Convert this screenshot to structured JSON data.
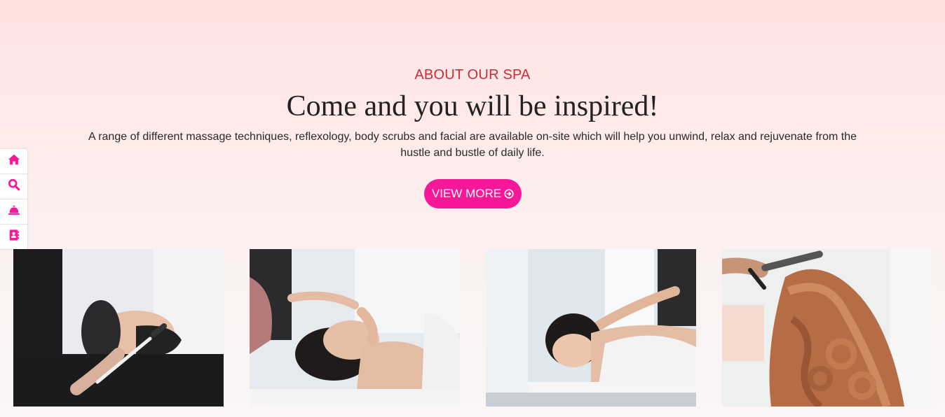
{
  "about": {
    "eyebrow": "ABOUT OUR SPA",
    "headline": "Come and you will be inspired!",
    "description": "A range of different massage techniques, reflexology, body scrubs and facial are available on-site which will help you unwind, relax and rejuvenate from the hustle and bustle of daily life.",
    "button_label": "VIEW MORE"
  },
  "side_toolbar": [
    {
      "icon": "home-icon"
    },
    {
      "icon": "search-icon"
    },
    {
      "icon": "service-bell-icon"
    },
    {
      "icon": "contact-book-icon"
    }
  ],
  "gallery": [
    {
      "subject": "facial-mask-photo"
    },
    {
      "subject": "face-massage-photo"
    },
    {
      "subject": "back-massage-photo"
    },
    {
      "subject": "hair-curling-photo"
    }
  ],
  "colors": {
    "accent": "#f7189a",
    "eyebrow": "#cc2b3b",
    "heading": "#222222"
  }
}
